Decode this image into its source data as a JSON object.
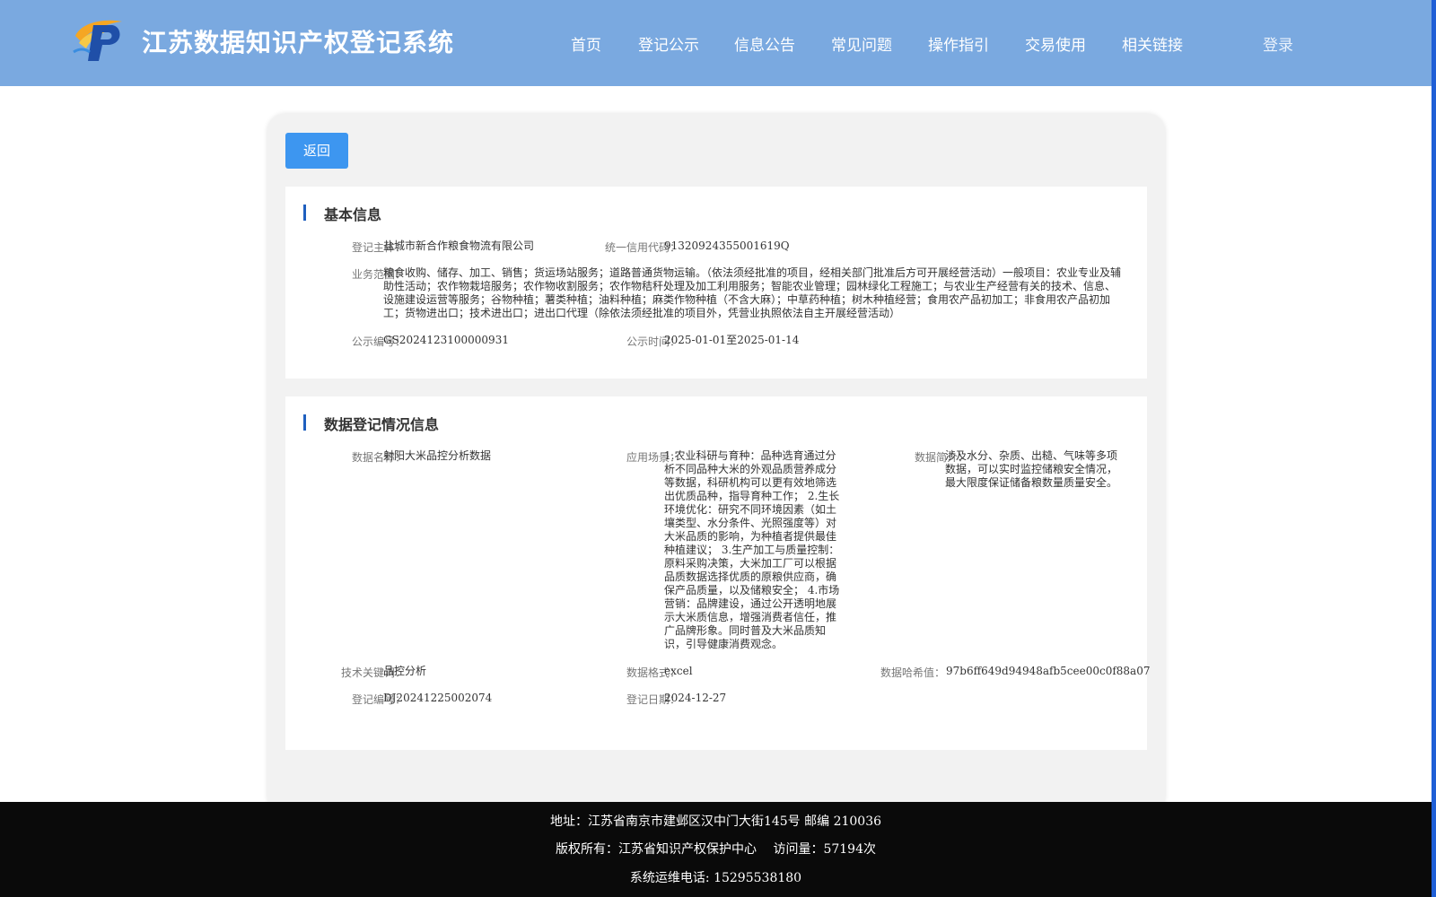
{
  "header": {
    "title": "江苏数据知识产权登记系统",
    "nav": [
      "首页",
      "登记公示",
      "信息公告",
      "常见问题",
      "操作指引",
      "交易使用",
      "相关链接"
    ],
    "login": "登录"
  },
  "back_button": "返回",
  "basic_info": {
    "title": "基本信息",
    "subject_label": "登记主体：",
    "subject": "盐城市新合作粮食物流有限公司",
    "credit_code_label": "统一信用代码：",
    "credit_code": "91320924355001619Q",
    "scope_label": "业务范围：",
    "scope": "粮食收购、储存、加工、销售；货运场站服务；道路普通货物运输。（依法须经批准的项目，经相关部门批准后方可开展经营活动）一般项目：农业专业及辅助性活动；农作物栽培服务；农作物收割服务；农作物秸秆处理及加工利用服务；智能农业管理；园林绿化工程施工；与农业生产经营有关的技术、信息、设施建设运营等服务；谷物种植；薯类种植；油料种植；麻类作物种植（不含大麻）；中草药种植；树木种植经营；食用农产品初加工；非食用农产品初加工；货物进出口；技术进出口；进出口代理（除依法须经批准的项目外，凭营业执照依法自主开展经营活动）",
    "notice_no_label": "公示编号：",
    "notice_no": "GS2024123100000931",
    "notice_time_label": "公示时间：",
    "notice_time": "2025-01-01至2025-01-14"
  },
  "registration_info": {
    "title": "数据登记情况信息",
    "data_name_label": "数据名称：",
    "data_name": "射阳大米品控分析数据",
    "scenario_label": "应用场景：",
    "scenario": "1.农业科研与育种：品种选育通过分析不同品种大米的外观品质营养成分等数据，科研机构可以更有效地筛选出优质品种，指导育种工作； 2.生长环境优化：研究不同环境因素（如土壤类型、水分条件、光照强度等）对大米品质的影响，为种植者提供最佳种植建议； 3.生产加工与质量控制：原料采购决策，大米加工厂可以根据品质数据选择优质的原粮供应商，确保产品质量，以及储粮安全； 4.市场营销：品牌建设，通过公开透明地展示大米质信息，增强消费者信任，推广品牌形象。同时普及大米品质知识，引导健康消费观念。",
    "intro_label": "数据简介：",
    "intro": "涉及水分、杂质、出糙、气味等多项数据，可以实时监控储粮安全情况，最大限度保证储备粮数量质量安全。",
    "keyword_label": "技术关键词：",
    "keyword": "品控分析",
    "format_label": "数据格式：",
    "format": "excel",
    "hash_label": "数据哈希值：",
    "hash": "97b6ff649d94948afb5cee00c0f88a07",
    "reg_no_label": "登记编号：",
    "reg_no": "DJ20241225002074",
    "reg_date_label": "登记日期：",
    "reg_date": "2024-12-27"
  },
  "footer": {
    "address": "地址：江苏省南京市建邺区汉中门大街145号 邮编 210036",
    "copyright": "版权所有：江苏省知识产权保护中心　  访问量：57194次",
    "phone": "系统运维电话: 15295538180"
  }
}
